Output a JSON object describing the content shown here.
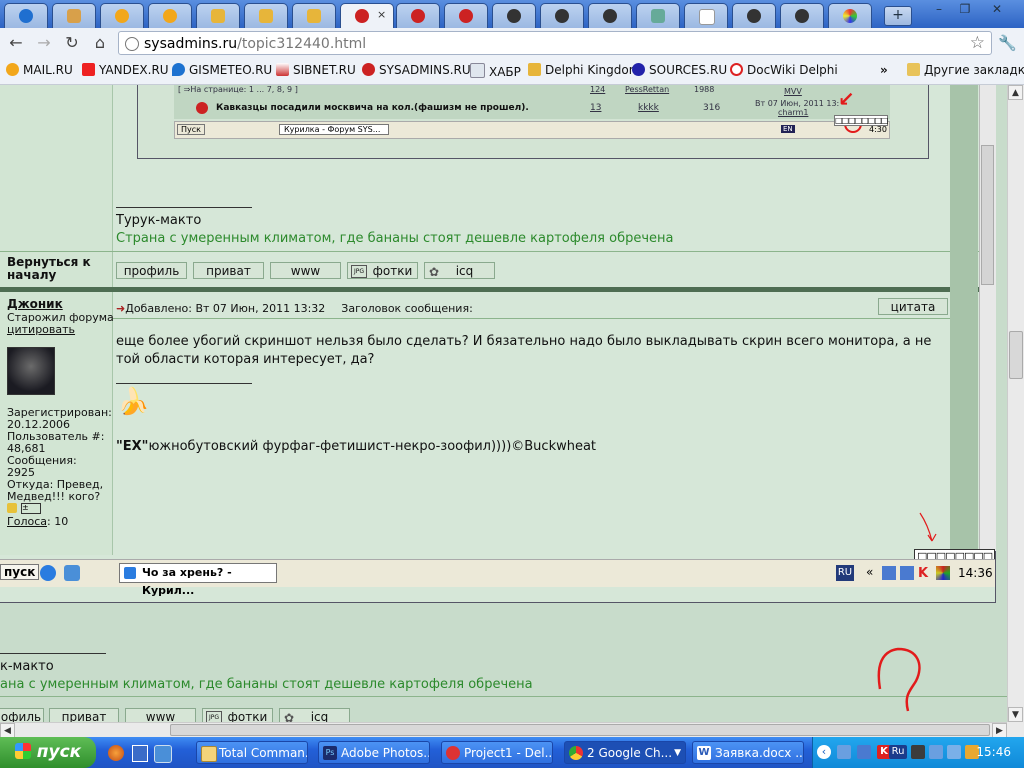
{
  "browser": {
    "tabs_count": 19,
    "active_tab_close": "×",
    "new_tab": "+",
    "window_buttons": [
      "–",
      "❐",
      "✕"
    ],
    "url_domain": "sysadmins.ru",
    "url_path": "/topic312440.html"
  },
  "bookmarks": {
    "items": [
      "MAIL.RU",
      "YANDEX.RU",
      "GISMETEO.RU",
      "SIBNET.RU",
      "SYSADMINS.RU",
      "ХАБР",
      "Delphi Kingdom",
      "SOURCES.RU",
      "DocWiki Delphi"
    ],
    "more": "»",
    "other": "Другие закладки"
  },
  "inner": {
    "tiny_row1": "[ ⇒На странице: 1 ... 7, 8, 9 ]",
    "tiny_row1_nums": [
      "124",
      "PessRettan",
      "1988",
      "MVV"
    ],
    "tiny_row2": "Кавказцы посадили москвича на кол.(фашизм не прошел).",
    "tiny_row2_nums": [
      "13",
      "kkkk",
      "316"
    ],
    "tiny_row2_date": "Вт 07 Июн, 2011 13:",
    "tiny_row2_user": "charm1",
    "tiny_task_start": "Пуск",
    "tiny_task_window": "Курилка - Форум SYS...",
    "tiny_task_lang": "EN",
    "tiny_task_time": "4:30",
    "sig1_name": "Турук-макто",
    "sig1_text": "Страна с умеренным климатом, где бананы стоят дешевле картофеля обречена",
    "back_to_top": "Вернуться к началу",
    "profile_buttons": [
      "профиль",
      "приват",
      "www",
      "фотки",
      "icq"
    ],
    "post": {
      "author": "Джоник",
      "rank": "Старожил форума",
      "quote_link": "цитировать",
      "registered_label": "Зарегистрирован:",
      "registered": "20.12.2006",
      "user_num_label": "Пользователь #:",
      "user_num": "48,681",
      "messages_label": "Сообщения:",
      "messages": "2925",
      "from": "Откуда: Превед, Медвед!!! кого?",
      "votes_label": "Голоса",
      "votes": ": 10",
      "added": "Добавлено: Вт 07 Июн, 2011 13:32",
      "subject_label": "Заголовок сообщения:",
      "quote_button": "цитата",
      "body": "еще более убогий скриншот нельзя было сделать? И бязательно надо было выкладывать скрин всего монитора, а не той области которая интересует, да?",
      "sig_bold": "\"EX\"",
      "sig_rest": "южнобутовский фурфаг-фетишист-некро-зоофил))))©Buckwheat"
    },
    "task_start": "пуск",
    "task_window": "Чо за хрень? - Курил...",
    "task_lang": "RU",
    "task_chevron": "«",
    "task_time": "14:36",
    "tray_boxes": "□□□□□□□□"
  },
  "outer": {
    "sig_name": "к-макто",
    "sig_text": "ана с умеренным климатом, где бананы стоят дешевле картофеля обречена",
    "buttons": [
      "офиль",
      "приват",
      "www",
      "фотки",
      "icq"
    ],
    "question": "?"
  },
  "taskbar": {
    "start": "пуск",
    "buttons": [
      "Total Comman...",
      "Adobe Photos...",
      "Project1 - Del...",
      "2 Google Ch...",
      "Заявка.docx ..."
    ],
    "tray_lang": "Ru",
    "clock": "15:46"
  },
  "colors": {
    "link": "#1b3c8c",
    "signature_green": "#2c8a2c",
    "annotation_red": "#e21b1b"
  }
}
